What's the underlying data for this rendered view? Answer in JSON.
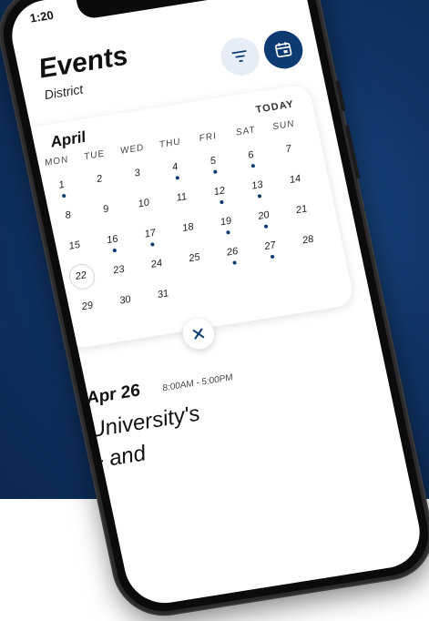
{
  "status": {
    "time": "1:20"
  },
  "header": {
    "title": "Events",
    "subtitle": "District"
  },
  "calendar": {
    "month": "April",
    "today_label": "TODAY",
    "weekdays": [
      "MON",
      "TUE",
      "WED",
      "THU",
      "FRI",
      "SAT",
      "SUN"
    ],
    "days": [
      "1",
      "2",
      "3",
      "4",
      "5",
      "6",
      "7",
      "8",
      "9",
      "10",
      "11",
      "12",
      "13",
      "14",
      "15",
      "16",
      "17",
      "18",
      "19",
      "20",
      "21",
      "22",
      "23",
      "24",
      "25",
      "26",
      "27",
      "28",
      "29",
      "30",
      "31"
    ],
    "event_days": [
      "1",
      "4",
      "5",
      "6",
      "12",
      "13",
      "16",
      "17",
      "19",
      "20",
      "26",
      "27"
    ],
    "selected_day": "22"
  },
  "event": {
    "date": "Apr 26",
    "time": "8:00AM - 5:00PM",
    "title": "University's",
    "title_cont": "- and"
  },
  "colors": {
    "brand": "#0e3a72",
    "background": "#0f3465"
  },
  "icons": {
    "filter": "filter-icon",
    "calendar": "calendar-icon",
    "close": "close-icon"
  }
}
